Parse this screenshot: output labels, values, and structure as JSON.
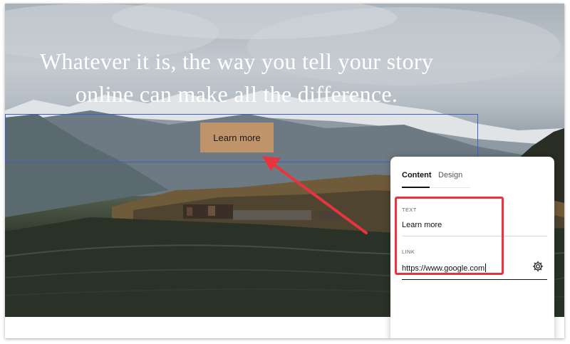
{
  "hero": {
    "headline_line1": "Whatever it is, the way you tell your story",
    "headline_line2": "online can make all the difference."
  },
  "button": {
    "label": "Learn more"
  },
  "panel": {
    "tabs": [
      {
        "label": "Content",
        "active": true
      },
      {
        "label": "Design",
        "active": false
      }
    ],
    "text_field": {
      "label": "TEXT",
      "value": "Learn more"
    },
    "link_field": {
      "label": "LINK",
      "value": "https://www.google.com"
    },
    "settings_icon": "gear-icon"
  },
  "colors": {
    "button_bg": "#c0946a",
    "selection_outline": "#3f5fc7",
    "annotation_red": "#e8343f"
  }
}
